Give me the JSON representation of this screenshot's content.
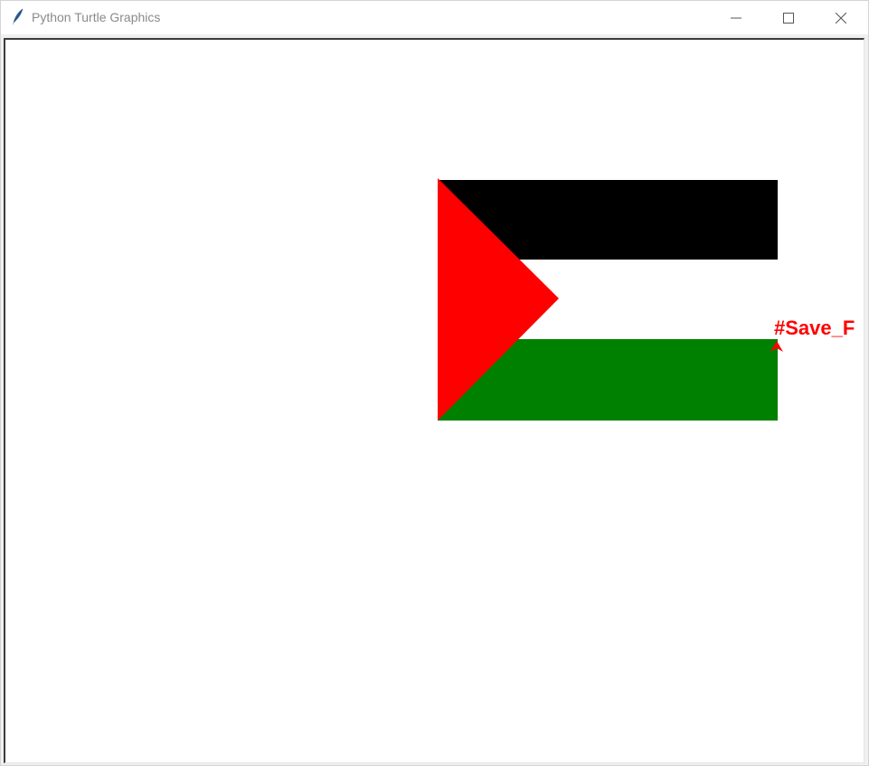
{
  "window": {
    "title": "Python Turtle Graphics",
    "icon": "feather-icon",
    "controls": {
      "minimize": "minimize-icon",
      "maximize": "maximize-icon",
      "close": "close-icon"
    }
  },
  "canvas": {
    "background": "#ffffff",
    "label_text": "#Save_F",
    "label_color": "#ff0000",
    "turtle_color": "#ff0000",
    "flag": {
      "stripe_colors": [
        "#000000",
        "#ffffff",
        "#008000"
      ],
      "triangle_color": "#ff0000"
    }
  }
}
